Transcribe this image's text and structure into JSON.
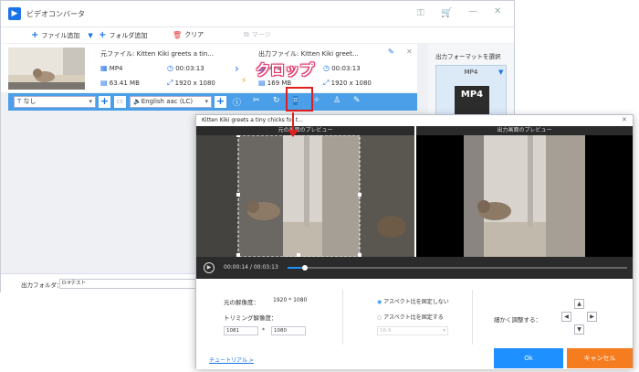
{
  "app": {
    "title": "ビデオコンバータ"
  },
  "toolbar": {
    "add_file": "ファイル追加",
    "add_folder": "フォルダ追加",
    "clear": "クリア",
    "merge": "マージ"
  },
  "file": {
    "source_label": "元ファイル: Kitten Kiki greets a tin...",
    "output_label": "出力ファイル: Kitten Kiki greet...",
    "src_format": "MP4",
    "src_duration": "00:03:13",
    "src_size": "63.41 MB",
    "src_resolution": "1920 x 1080",
    "out_format": "MP4",
    "out_duration": "00:03:13",
    "out_size": "169 MB",
    "out_resolution": "1920 x 1080"
  },
  "editbar": {
    "subtitle": "なし",
    "audio": "English aac (LC)"
  },
  "right_panel": {
    "title": "出力フォーマットを選択",
    "format": "MP4"
  },
  "callout": {
    "text": "クロップ"
  },
  "output": {
    "label": "出力フォルダ：",
    "path": "D:¥テスト"
  },
  "dialog": {
    "title": "Kitten Kiki greets a tiny chicks for t...",
    "orig_preview": "元の画面のプレビュー",
    "out_preview": "出力画面のプレビュー",
    "time_current": "00:00:14",
    "time_sep": "/",
    "time_total": "00:03:13",
    "progress": 0.05,
    "orig_res_label": "元の解像度：",
    "orig_res_value": "1920 * 1080",
    "trim_res_label": "トリミング解像度：",
    "width": "1081",
    "times": "*",
    "height": "1080",
    "ratio_free": "アスペクト比を固定しない",
    "ratio_fixed": "アスペクト比を固定する",
    "ratio_placeholder": "16:9",
    "fine_tune": "細かく調整する：",
    "tutorial": "チュートリアル >",
    "ok": "Ok",
    "cancel": "キャンセル"
  }
}
